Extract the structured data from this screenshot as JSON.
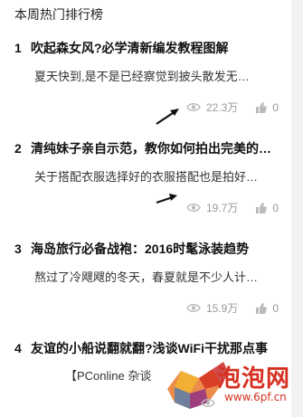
{
  "header": {
    "title": "本周热门排行榜"
  },
  "items": [
    {
      "rank": "1",
      "title": "吹起森女风?必学清新编发教程图解",
      "summary": "夏天快到,是不是已经察觉到披头散发无…",
      "views": "22.3万",
      "likes": "0"
    },
    {
      "rank": "2",
      "title": "清纯妹子亲自示范，教你如何拍出完美的…",
      "summary": "关于搭配衣服选择好的衣服搭配也是拍好…",
      "views": "19.7万",
      "likes": "0"
    },
    {
      "rank": "3",
      "title": "海岛旅行必备战袍：2016时髦泳装趋势",
      "summary": "熬过了冷飕飕的冬天，春夏就是不少人计…",
      "views": "15.9万",
      "likes": "0"
    },
    {
      "rank": "4",
      "title": "友谊的小船说翻就翻?浅谈WiFi干扰那点事",
      "summary": "【PConline 杂谈",
      "views": "",
      "likes": "0"
    }
  ],
  "watermark": {
    "text": "泡泡网",
    "url": "www.6pf.cn"
  },
  "colors": {
    "watermark_red": "#d63020",
    "meta_gray": "#999999"
  }
}
